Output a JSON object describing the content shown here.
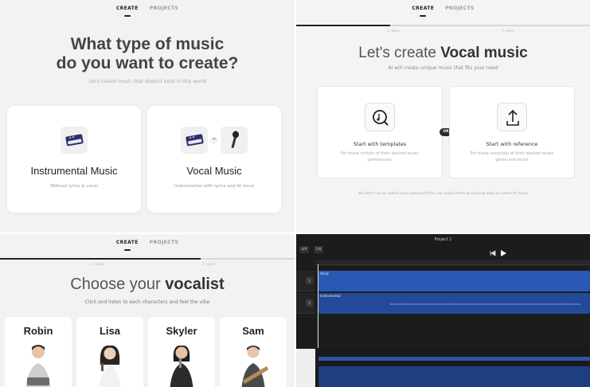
{
  "nav": {
    "create": "CREATE",
    "projects": "PROJECTS"
  },
  "q1": {
    "title_line1": "What type of music",
    "title_line2": "do you want to create?",
    "subtitle": "Let's create music that doesn't exist in this world",
    "cards": [
      {
        "title": "Instrumental Music",
        "desc": "Without lyrics & vocal"
      },
      {
        "title": "Vocal Music",
        "desc": "Instrumental with lyrics and AI vocal"
      }
    ]
  },
  "q2": {
    "step1": "1. Vocal",
    "step2": "2. Lyrics",
    "title_prefix": "Let's create ",
    "title_bold": "Vocal music",
    "subtitle": "AI will create unique music that fits your need",
    "cards": [
      {
        "title": "Start with templates",
        "desc": "For those certain of their desired music preferences"
      },
      {
        "title": "Start with reference",
        "desc": "For those uncertain of their desired music genre and mood"
      }
    ],
    "or": "OR",
    "footnote": "We don't use or collect user-uploaded files, nor utilize them as training data to create AI music"
  },
  "q3": {
    "step1": "1. Vocal",
    "step2": "2. Lyrics",
    "title_prefix": "Choose your ",
    "title_bold": "vocalist",
    "subtitle": "Click and listen to each characters and feel the vibe",
    "vocalists": [
      "Robin",
      "Lisa",
      "Skyler",
      "Sam"
    ]
  },
  "q4": {
    "project": "Project 1",
    "time_sig": "4/4",
    "tempo_frac": "1/8",
    "tracks": [
      {
        "num": "1",
        "name": "Vocal"
      },
      {
        "num": "2",
        "name": "Instrumental"
      }
    ]
  },
  "colors": {
    "track_blue": "#2a58b5",
    "track_blue_dark": "#234a96",
    "daw_bg": "#1c1c1d"
  }
}
